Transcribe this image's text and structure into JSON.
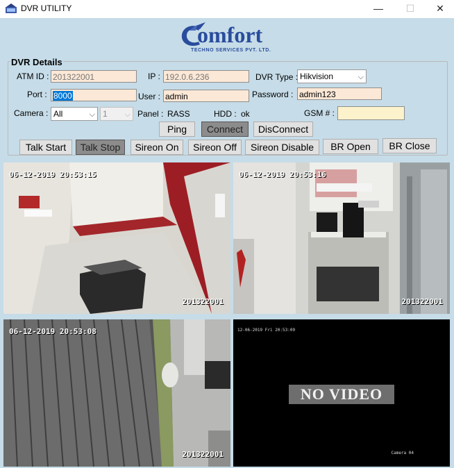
{
  "window": {
    "title": "DVR UTILITY",
    "minimize": "—",
    "maximize": "☐",
    "close": "✕"
  },
  "logo": {
    "brand": "omfort",
    "tagline": "TECHNO SERVICES PVT. LTD."
  },
  "details": {
    "legend": "DVR Details",
    "atm_label": "ATM ID :",
    "atm_value": "201322001",
    "ip_label": "IP :",
    "ip_value": "192.0.6.236",
    "dvr_type_label": "DVR Type :",
    "dvr_type_value": "Hikvision",
    "port_label": "Port :",
    "port_value": "8000",
    "user_label": "User :",
    "user_value": "admin",
    "password_label": "Password :",
    "password_value": "admin123",
    "camera_label": "Camera :",
    "camera_value": "All",
    "channel_value": "1",
    "panel_label": "Panel :",
    "panel_value": "RASS",
    "hdd_label": "HDD :",
    "hdd_value": "ok",
    "gsm_label": "GSM # :",
    "gsm_value": ""
  },
  "buttons": {
    "ping": "Ping",
    "connect": "Connect",
    "disconnect": "DisConnect",
    "talk_start": "Talk Start",
    "talk_stop": "Talk Stop",
    "sireon_on": "Sireon On",
    "sireon_off": "Sireon Off",
    "sireon_disable": "Sireon Disable",
    "br_open": "BR Open",
    "br_close": "BR Close"
  },
  "cameras": [
    {
      "timestamp": "06-12-2019 20:53:15",
      "id": "201322001"
    },
    {
      "timestamp": "06-12-2019 20:53:16",
      "id": "201322001"
    },
    {
      "timestamp": "06-12-2019 20:53:08",
      "id": "201322001"
    },
    {
      "timestamp": "12-06-2019 Fri 20:53:09",
      "status": "NO VIDEO",
      "channel_label": "Camera 04"
    }
  ]
}
